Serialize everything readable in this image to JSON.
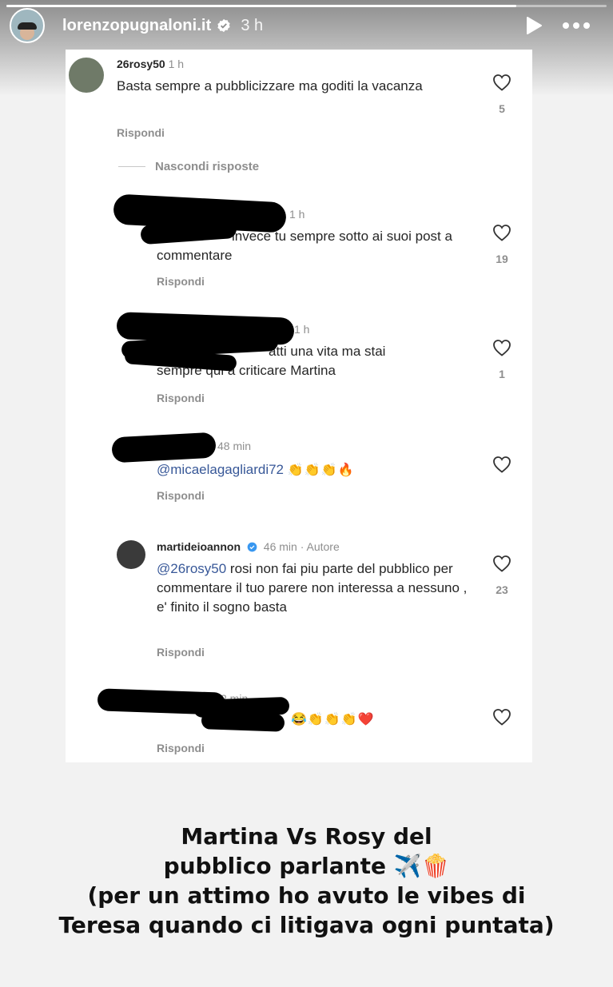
{
  "story": {
    "username": "lorenzopugnaloni.it",
    "time": "3 h",
    "progress_fraction": 0.85
  },
  "comments": [
    {
      "user": "26rosy50",
      "time": "1 h",
      "text": "Basta sempre a pubblicizzare ma goditi la vacanza",
      "likes": "5",
      "reply": "Rispondi"
    },
    {
      "user": "",
      "time": "1 h",
      "text": "invece tu sempre sotto ai suoi post a commentare",
      "likes": "19",
      "reply": "Rispondi"
    },
    {
      "user": "",
      "time": "1 h",
      "text": "atti una vita ma stai sempre qui a criticare Martina",
      "likes": "1",
      "reply": "Rispondi"
    },
    {
      "user": "",
      "time": "48 min",
      "mention": "@micaelagagliardi72",
      "emojis": "👏👏👏🔥",
      "likes": "",
      "reply": "Rispondi"
    },
    {
      "user": "martideioannon",
      "time": "46 min · Autore",
      "mention": "@26rosy50",
      "text": " rosi non fai piu parte del pubblico per commentare il tuo parere non interessa a nessuno , e' finito il sogno basta",
      "likes": "23",
      "reply": "Rispondi"
    },
    {
      "user": "",
      "time": "2 min",
      "emojis": "😂👏👏👏❤️",
      "likes": "",
      "reply": "Rispondi"
    }
  ],
  "hide_replies": "Nascondi risposte",
  "caption": {
    "line1": "Martina Vs Rosy del",
    "line2": "pubblico parlante ✈️🍿",
    "line3": "(per un attimo ho avuto le vibes di",
    "line4": "Teresa quando ci litigava ogni puntata)"
  },
  "colors": {
    "mention": "#385898",
    "verified": "#3897f0"
  },
  "icons": [
    "play-icon",
    "more-icon",
    "heart-icon",
    "verified-icon"
  ]
}
